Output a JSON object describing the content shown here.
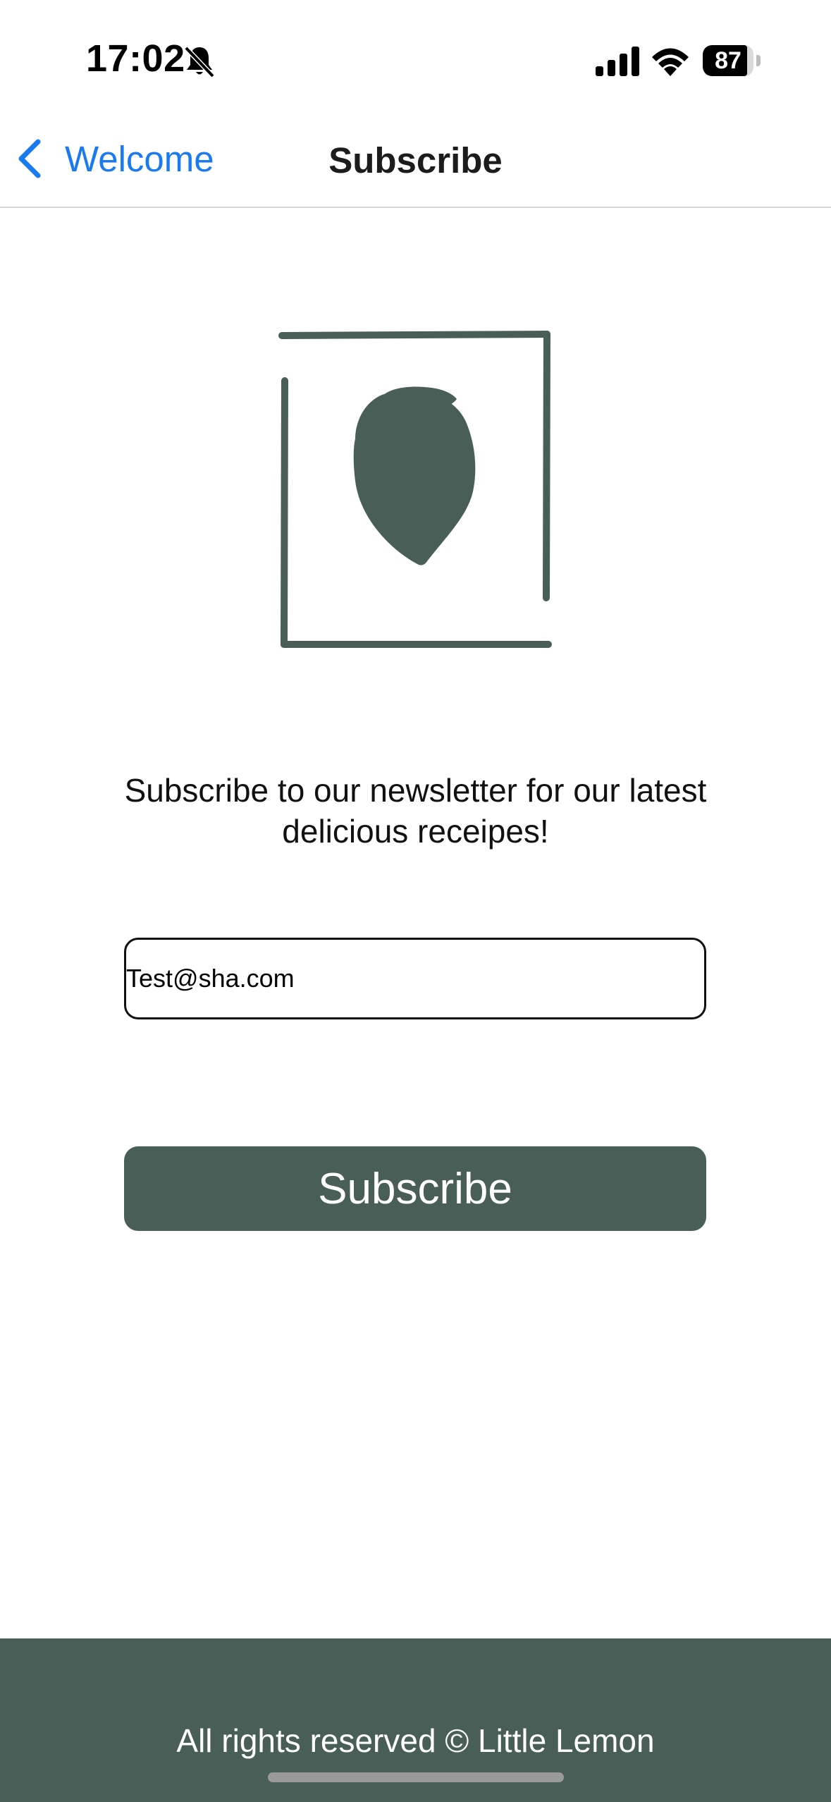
{
  "status_bar": {
    "time": "17:02",
    "battery_level": "87",
    "battery_fraction": 0.87,
    "icons": [
      "bell-slash-icon",
      "cellular-signal-icon",
      "wifi-icon",
      "battery-icon"
    ]
  },
  "nav": {
    "back_label": "Welcome",
    "title": "Subscribe"
  },
  "logo": {
    "name": "little-lemon-logo-icon",
    "color": "#495e57"
  },
  "content": {
    "description": "Subscribe to our newsletter for our latest delicious receipes!",
    "email_value": "Test@sha.com",
    "subscribe_label": "Subscribe"
  },
  "footer": {
    "text": "All rights reserved © Little Lemon"
  },
  "colors": {
    "brand": "#495e57",
    "link": "#1a7bf0",
    "background": "#ffffff"
  }
}
